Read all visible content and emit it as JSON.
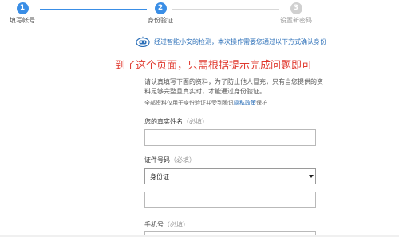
{
  "steps": [
    {
      "number": "1",
      "label": "填写帐号"
    },
    {
      "number": "2",
      "label": "身份验证"
    },
    {
      "number": "3",
      "label": "设置新密码"
    }
  ],
  "notice": {
    "icon": "security-robot-icon",
    "text": "经过智能小安的检测，本次操作需要您通过以下方式确认身份"
  },
  "caption": "到了这个页面，只需根据提示完成问题即可",
  "intro": {
    "text": "请认真填写下面的资料，为了防止他人冒充，只有当您提供的资料足够完整且真实时，才能通过身份验证。",
    "privacy_prefix": "全部资料仅用于身份验证并受到腾讯",
    "privacy_link": "隐私政策",
    "privacy_suffix": "保护"
  },
  "form": {
    "name": {
      "label": "您的真实姓名",
      "required": "（必填）",
      "value": ""
    },
    "id_type": {
      "label": "证件号码",
      "required": "（必填）",
      "selected": "身份证"
    },
    "id_number": {
      "value": ""
    },
    "phone": {
      "label": "手机号",
      "required": "（必填）"
    }
  },
  "colors": {
    "accent": "#3a8ee6",
    "caption": "#e03a2f",
    "link": "#2b6fb8"
  }
}
